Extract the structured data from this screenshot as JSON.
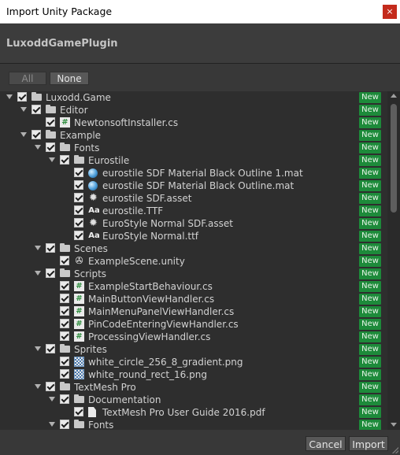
{
  "window": {
    "title": "Import Unity Package",
    "close_glyph": "×"
  },
  "package": {
    "name": "LuxoddGamePlugin"
  },
  "selection": {
    "all_label": "All",
    "none_label": "None"
  },
  "badge_label": "New",
  "tree": [
    {
      "label": "Luxodd.Game",
      "type": "folder",
      "depth": 0,
      "expanded": true,
      "checked": true
    },
    {
      "label": "Editor",
      "type": "folder",
      "depth": 1,
      "expanded": true,
      "checked": true
    },
    {
      "label": "NewtonsoftInstaller.cs",
      "type": "cs",
      "depth": 2,
      "checked": true
    },
    {
      "label": "Example",
      "type": "folder",
      "depth": 1,
      "expanded": true,
      "checked": true
    },
    {
      "label": "Fonts",
      "type": "folder",
      "depth": 2,
      "expanded": true,
      "checked": true
    },
    {
      "label": "Eurostile",
      "type": "folder",
      "depth": 3,
      "expanded": true,
      "checked": true
    },
    {
      "label": "eurostile SDF Material Black Outline 1.mat",
      "type": "mat",
      "depth": 4,
      "checked": true
    },
    {
      "label": "eurostile SDF Material Black Outline.mat",
      "type": "mat",
      "depth": 4,
      "checked": true
    },
    {
      "label": "eurostile SDF.asset",
      "type": "asset",
      "depth": 4,
      "checked": true
    },
    {
      "label": "eurostile.TTF",
      "type": "font",
      "depth": 4,
      "checked": true
    },
    {
      "label": "EuroStyle Normal SDF.asset",
      "type": "asset",
      "depth": 4,
      "checked": true
    },
    {
      "label": "EuroStyle Normal.ttf",
      "type": "font",
      "depth": 4,
      "checked": true
    },
    {
      "label": "Scenes",
      "type": "folder",
      "depth": 2,
      "expanded": true,
      "checked": true
    },
    {
      "label": "ExampleScene.unity",
      "type": "scene",
      "depth": 3,
      "checked": true
    },
    {
      "label": "Scripts",
      "type": "folder",
      "depth": 2,
      "expanded": true,
      "checked": true
    },
    {
      "label": "ExampleStartBehaviour.cs",
      "type": "cs",
      "depth": 3,
      "checked": true
    },
    {
      "label": "MainButtonViewHandler.cs",
      "type": "cs",
      "depth": 3,
      "checked": true
    },
    {
      "label": "MainMenuPanelViewHandler.cs",
      "type": "cs",
      "depth": 3,
      "checked": true
    },
    {
      "label": "PinCodeEnteringViewHandler.cs",
      "type": "cs",
      "depth": 3,
      "checked": true
    },
    {
      "label": "ProcessingViewHandler.cs",
      "type": "cs",
      "depth": 3,
      "checked": true
    },
    {
      "label": "Sprites",
      "type": "folder",
      "depth": 2,
      "expanded": true,
      "checked": true
    },
    {
      "label": "white_circle_256_8_gradient.png",
      "type": "png",
      "depth": 3,
      "checked": true
    },
    {
      "label": "white_round_rect_16.png",
      "type": "png",
      "depth": 3,
      "checked": true
    },
    {
      "label": "TextMesh Pro",
      "type": "folder",
      "depth": 2,
      "expanded": true,
      "checked": true
    },
    {
      "label": "Documentation",
      "type": "folder",
      "depth": 3,
      "expanded": true,
      "checked": true
    },
    {
      "label": "TextMesh Pro User Guide 2016.pdf",
      "type": "pdf",
      "depth": 4,
      "checked": true
    },
    {
      "label": "Fonts",
      "type": "folder",
      "depth": 3,
      "expanded": true,
      "checked": true
    }
  ],
  "icon_names": {
    "folder": "folder-icon",
    "cs": "csharp-script-icon",
    "mat": "material-icon",
    "asset": "asset-icon",
    "font": "font-icon",
    "scene": "unity-scene-icon",
    "png": "texture-icon",
    "pdf": "document-icon"
  },
  "icon_glyphs": {
    "cs": "#",
    "asset": "✹",
    "font": "Aa",
    "scene": "✇"
  },
  "footer": {
    "cancel_label": "Cancel",
    "import_label": "Import"
  },
  "colors": {
    "badge": "#1d8a3a",
    "background": "#383838",
    "tree_bg": "#2e2e2e"
  }
}
